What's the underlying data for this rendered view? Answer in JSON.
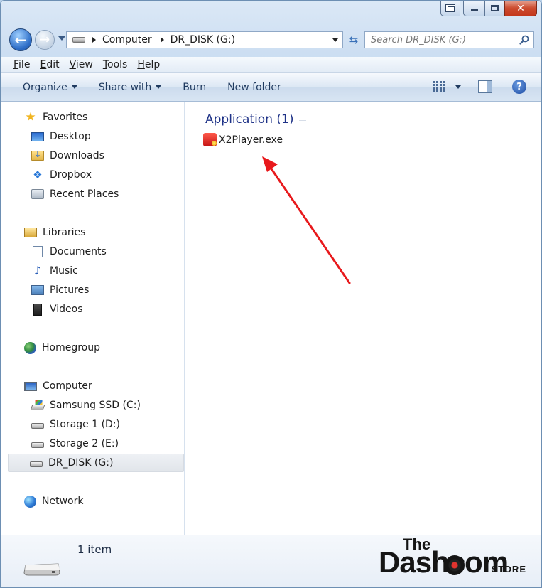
{
  "window": {
    "caption": {
      "close_label": "✕"
    }
  },
  "address_bar": {
    "breadcrumbs": [
      "Computer",
      "DR_DISK (G:)"
    ]
  },
  "search": {
    "placeholder": "Search DR_DISK (G:)"
  },
  "menu_bar": {
    "items": [
      {
        "underline": "F",
        "rest": "ile"
      },
      {
        "underline": "E",
        "rest": "dit"
      },
      {
        "underline": "V",
        "rest": "iew"
      },
      {
        "underline": "T",
        "rest": "ools"
      },
      {
        "underline": "H",
        "rest": "elp"
      }
    ]
  },
  "command_bar": {
    "organize": "Organize",
    "share_with": "Share with",
    "burn": "Burn",
    "new_folder": "New folder",
    "help_glyph": "?"
  },
  "nav_pane": {
    "favorites": "Favorites",
    "desktop": "Desktop",
    "downloads": "Downloads",
    "dropbox": "Dropbox",
    "recent_places": "Recent Places",
    "libraries": "Libraries",
    "documents": "Documents",
    "music": "Music",
    "pictures": "Pictures",
    "videos": "Videos",
    "homegroup": "Homegroup",
    "computer": "Computer",
    "samsung_ssd": "Samsung SSD (C:)",
    "storage1": "Storage 1 (D:)",
    "storage2": "Storage 2 (E:)",
    "dr_disk": "DR_DISK (G:)",
    "network": "Network"
  },
  "content": {
    "group_header": "Application (1)",
    "files": [
      {
        "name": "X2Player.exe",
        "icon": "exe-app-icon"
      }
    ],
    "annotation_color": "#e8191c"
  },
  "status": {
    "item_count": "1 item"
  },
  "watermark": {
    "the": "The",
    "dashcom": "Dashcom",
    "store": "STORE"
  },
  "colors": {
    "group_header": "#1e3287",
    "command_text": "#1f3a5f",
    "close_button": "#c4371c"
  }
}
